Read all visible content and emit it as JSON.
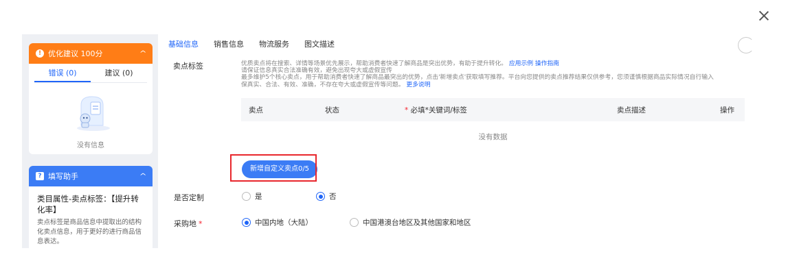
{
  "left_panel": {
    "optimize": {
      "title": "优化建议 100分",
      "tabs": [
        {
          "label": "错误 (0)",
          "active": true
        },
        {
          "label": "建议 (0)",
          "active": false
        }
      ],
      "empty_text": "没有信息"
    },
    "helper": {
      "title": "填写助手",
      "attr_title": "类目属性-卖点标签：【提升转化率】",
      "attr_body": "卖点标签是商品信息中提取出的结构化卖点信息，用于更好的进行商品信息表达。"
    }
  },
  "tabs": [
    {
      "label": "基础信息",
      "active": true
    },
    {
      "label": "销售信息",
      "active": false
    },
    {
      "label": "物流服务",
      "active": false
    },
    {
      "label": "图文描述",
      "active": false
    }
  ],
  "selling_points": {
    "label": "卖点标签",
    "desc_line1": "优质卖点将在搜索、详情等场景优先展示，帮助消费者快速了解商品是突出优势，有助于提升转化。",
    "desc_link1": "应用示例",
    "desc_link2": "操作指南",
    "desc_line2": "请保证信息真实合法准确有效，避免出现夸大或虚假宣传",
    "desc_line3": "最多维护5个核心卖点，用于帮助消费者快速了解商品最突出的优势，点击'新增卖点'获取填写推荐。平台向您提供的卖点推荐结果仅供参考，您须谨慎根据商品实际情况自行输入",
    "desc_line4": "保真实、合法、有效、准确，不存在夸大或虚假宣传等问题。",
    "desc_link3": "更多说明",
    "columns": {
      "point": "卖点",
      "status": "状态",
      "keyword_star": "*",
      "keyword": "必填*关键词/标签",
      "description": "卖点描述",
      "action": "操作"
    },
    "empty": "没有数据",
    "add_button": "新增自定义卖点0/5"
  },
  "customized": {
    "label": "是否定制",
    "options": [
      {
        "label": "是",
        "checked": false
      },
      {
        "label": "否",
        "checked": true
      }
    ]
  },
  "purchase_place": {
    "label": "采购地",
    "required_mark": "*",
    "options": [
      {
        "label": "中国内地（大陆）",
        "checked": true
      },
      {
        "label": "中国港澳台地区及其他国家和地区",
        "checked": false
      }
    ]
  },
  "colors": {
    "orange": "#ff7d16",
    "blue": "#3b7cf5",
    "primary": "#1f65f8",
    "highlight": "#e8262c"
  }
}
